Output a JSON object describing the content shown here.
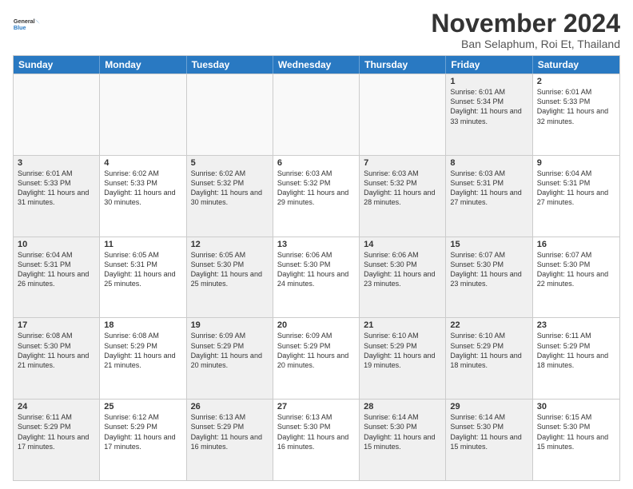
{
  "logo": {
    "line1": "General",
    "line2": "Blue"
  },
  "title": "November 2024",
  "location": "Ban Selaphum, Roi Et, Thailand",
  "header": {
    "days": [
      "Sunday",
      "Monday",
      "Tuesday",
      "Wednesday",
      "Thursday",
      "Friday",
      "Saturday"
    ]
  },
  "rows": [
    [
      {
        "num": "",
        "info": "",
        "empty": true
      },
      {
        "num": "",
        "info": "",
        "empty": true
      },
      {
        "num": "",
        "info": "",
        "empty": true
      },
      {
        "num": "",
        "info": "",
        "empty": true
      },
      {
        "num": "",
        "info": "",
        "empty": true
      },
      {
        "num": "1",
        "info": "Sunrise: 6:01 AM\nSunset: 5:34 PM\nDaylight: 11 hours and 33 minutes.",
        "shaded": true
      },
      {
        "num": "2",
        "info": "Sunrise: 6:01 AM\nSunset: 5:33 PM\nDaylight: 11 hours and 32 minutes.",
        "shaded": false
      }
    ],
    [
      {
        "num": "3",
        "info": "Sunrise: 6:01 AM\nSunset: 5:33 PM\nDaylight: 11 hours and 31 minutes.",
        "shaded": true
      },
      {
        "num": "4",
        "info": "Sunrise: 6:02 AM\nSunset: 5:33 PM\nDaylight: 11 hours and 30 minutes.",
        "shaded": false
      },
      {
        "num": "5",
        "info": "Sunrise: 6:02 AM\nSunset: 5:32 PM\nDaylight: 11 hours and 30 minutes.",
        "shaded": true
      },
      {
        "num": "6",
        "info": "Sunrise: 6:03 AM\nSunset: 5:32 PM\nDaylight: 11 hours and 29 minutes.",
        "shaded": false
      },
      {
        "num": "7",
        "info": "Sunrise: 6:03 AM\nSunset: 5:32 PM\nDaylight: 11 hours and 28 minutes.",
        "shaded": true
      },
      {
        "num": "8",
        "info": "Sunrise: 6:03 AM\nSunset: 5:31 PM\nDaylight: 11 hours and 27 minutes.",
        "shaded": true
      },
      {
        "num": "9",
        "info": "Sunrise: 6:04 AM\nSunset: 5:31 PM\nDaylight: 11 hours and 27 minutes.",
        "shaded": false
      }
    ],
    [
      {
        "num": "10",
        "info": "Sunrise: 6:04 AM\nSunset: 5:31 PM\nDaylight: 11 hours and 26 minutes.",
        "shaded": true
      },
      {
        "num": "11",
        "info": "Sunrise: 6:05 AM\nSunset: 5:31 PM\nDaylight: 11 hours and 25 minutes.",
        "shaded": false
      },
      {
        "num": "12",
        "info": "Sunrise: 6:05 AM\nSunset: 5:30 PM\nDaylight: 11 hours and 25 minutes.",
        "shaded": true
      },
      {
        "num": "13",
        "info": "Sunrise: 6:06 AM\nSunset: 5:30 PM\nDaylight: 11 hours and 24 minutes.",
        "shaded": false
      },
      {
        "num": "14",
        "info": "Sunrise: 6:06 AM\nSunset: 5:30 PM\nDaylight: 11 hours and 23 minutes.",
        "shaded": true
      },
      {
        "num": "15",
        "info": "Sunrise: 6:07 AM\nSunset: 5:30 PM\nDaylight: 11 hours and 23 minutes.",
        "shaded": true
      },
      {
        "num": "16",
        "info": "Sunrise: 6:07 AM\nSunset: 5:30 PM\nDaylight: 11 hours and 22 minutes.",
        "shaded": false
      }
    ],
    [
      {
        "num": "17",
        "info": "Sunrise: 6:08 AM\nSunset: 5:30 PM\nDaylight: 11 hours and 21 minutes.",
        "shaded": true
      },
      {
        "num": "18",
        "info": "Sunrise: 6:08 AM\nSunset: 5:29 PM\nDaylight: 11 hours and 21 minutes.",
        "shaded": false
      },
      {
        "num": "19",
        "info": "Sunrise: 6:09 AM\nSunset: 5:29 PM\nDaylight: 11 hours and 20 minutes.",
        "shaded": true
      },
      {
        "num": "20",
        "info": "Sunrise: 6:09 AM\nSunset: 5:29 PM\nDaylight: 11 hours and 20 minutes.",
        "shaded": false
      },
      {
        "num": "21",
        "info": "Sunrise: 6:10 AM\nSunset: 5:29 PM\nDaylight: 11 hours and 19 minutes.",
        "shaded": true
      },
      {
        "num": "22",
        "info": "Sunrise: 6:10 AM\nSunset: 5:29 PM\nDaylight: 11 hours and 18 minutes.",
        "shaded": true
      },
      {
        "num": "23",
        "info": "Sunrise: 6:11 AM\nSunset: 5:29 PM\nDaylight: 11 hours and 18 minutes.",
        "shaded": false
      }
    ],
    [
      {
        "num": "24",
        "info": "Sunrise: 6:11 AM\nSunset: 5:29 PM\nDaylight: 11 hours and 17 minutes.",
        "shaded": true
      },
      {
        "num": "25",
        "info": "Sunrise: 6:12 AM\nSunset: 5:29 PM\nDaylight: 11 hours and 17 minutes.",
        "shaded": false
      },
      {
        "num": "26",
        "info": "Sunrise: 6:13 AM\nSunset: 5:29 PM\nDaylight: 11 hours and 16 minutes.",
        "shaded": true
      },
      {
        "num": "27",
        "info": "Sunrise: 6:13 AM\nSunset: 5:30 PM\nDaylight: 11 hours and 16 minutes.",
        "shaded": false
      },
      {
        "num": "28",
        "info": "Sunrise: 6:14 AM\nSunset: 5:30 PM\nDaylight: 11 hours and 15 minutes.",
        "shaded": true
      },
      {
        "num": "29",
        "info": "Sunrise: 6:14 AM\nSunset: 5:30 PM\nDaylight: 11 hours and 15 minutes.",
        "shaded": true
      },
      {
        "num": "30",
        "info": "Sunrise: 6:15 AM\nSunset: 5:30 PM\nDaylight: 11 hours and 15 minutes.",
        "shaded": false
      }
    ]
  ]
}
